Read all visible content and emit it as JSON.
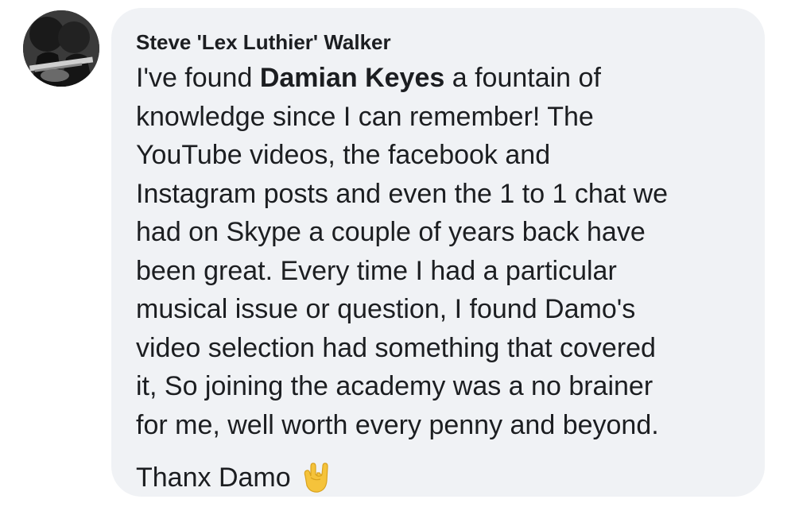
{
  "comment": {
    "author": "Steve 'Lex Luthier' Walker",
    "lines": [
      {
        "pre": "I've found ",
        "mention": "Damian Keyes",
        "post": " a fountain of"
      },
      {
        "text": "knowledge since I can remember! The"
      },
      {
        "text": "YouTube videos, the facebook and"
      },
      {
        "text": "Instagram posts and even the 1 to 1 chat we"
      },
      {
        "text": "had on Skype a couple of years back have"
      },
      {
        "text": "been great. Every time I had a particular"
      },
      {
        "text": "musical issue or question, I found Damo's"
      },
      {
        "text": "video selection had something that covered"
      },
      {
        "text": "it, So joining the academy was a no brainer"
      },
      {
        "text": "for me, well worth every penny and beyond."
      }
    ],
    "signoff": "Thanx Damo",
    "emoji": "sign-of-the-horns-emoji"
  },
  "colors": {
    "bubble": "#f0f2f5",
    "text": "#1c1e21",
    "emoji": "#f5c33b"
  }
}
